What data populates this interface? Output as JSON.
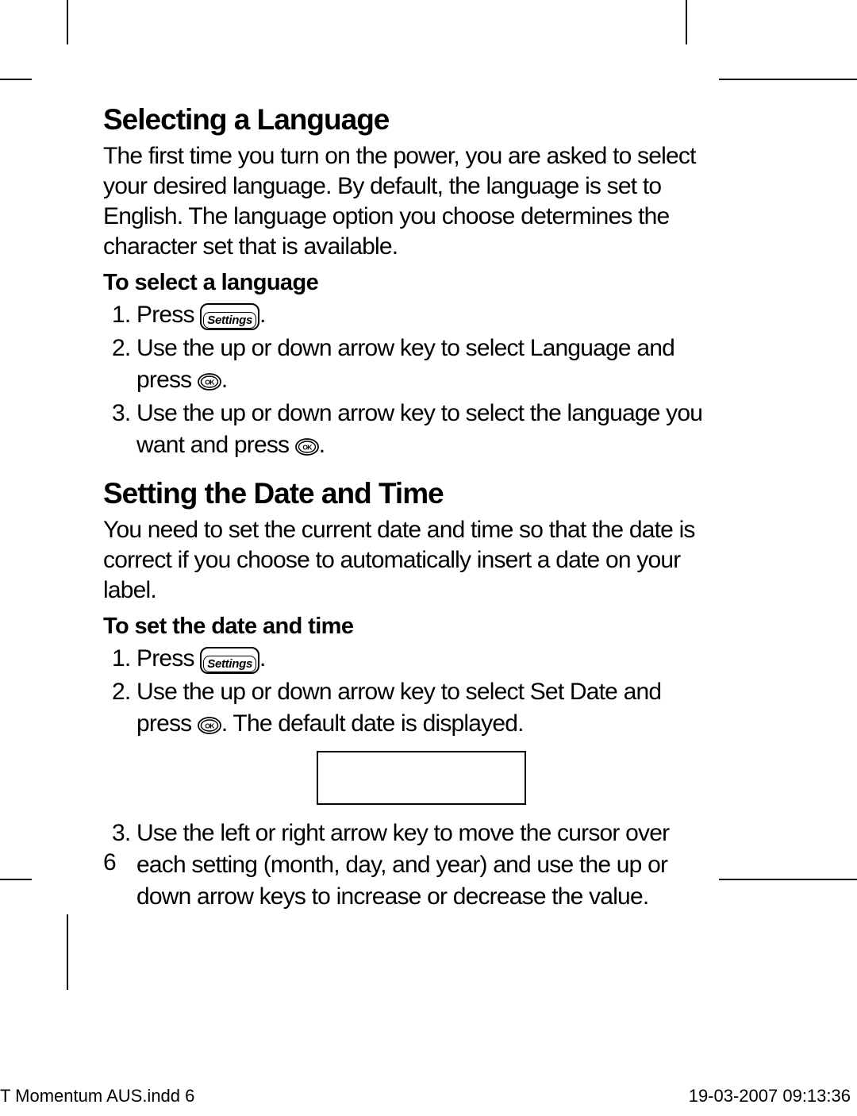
{
  "section1": {
    "heading": "Selecting a Language",
    "intro": "The first time you turn on the power, you are asked to select your desired language. By default, the language is set to English. The language option you choose determines the character set that is available.",
    "subheading": "To select a language",
    "step1_a": "Press ",
    "step1_b": ".",
    "step2_a": "Use the up or down arrow key to select Language and press ",
    "step2_b": ".",
    "step3_a": "Use the up or down arrow key to select the language you want and press ",
    "step3_b": "."
  },
  "section2": {
    "heading": "Setting the Date and Time",
    "intro": "You need to set the current date and time so that the date is correct if you choose to automatically insert a date on your label.",
    "subheading": "To set the date and time",
    "step1_a": "Press ",
    "step1_b": ".",
    "step2_a": "Use the up or down arrow key to select Set Date and press ",
    "step2_b": ". The default date is displayed.",
    "step3": "Use the left or right arrow key to move the cursor over each setting (month, day, and year) and use the up or down arrow keys to increase or decrease the value."
  },
  "buttons": {
    "settings_label": "Settings",
    "ok_label": "OK"
  },
  "page_number": "6",
  "footer": {
    "left": "T  Momentum AUS.indd   6",
    "right": "19-03-2007   09:13:36"
  }
}
